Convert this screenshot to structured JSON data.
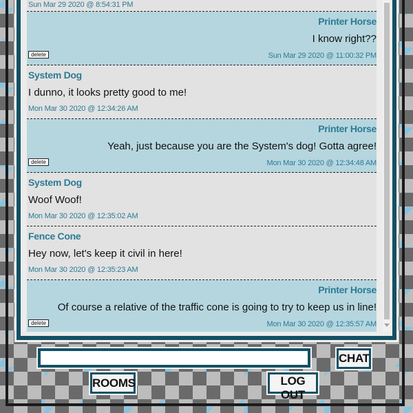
{
  "messages": [
    {
      "author": "",
      "text": "",
      "time": "Sun Mar 29 2020 @ 8:54:31 PM",
      "own": false
    },
    {
      "author": "Printer Horse",
      "text": "I know right??",
      "time": "Sun Mar 29 2020 @ 11:00:32 PM",
      "own": true,
      "delete_label": "delete"
    },
    {
      "author": "System Dog",
      "text": "I dunno, it looks pretty good to me!",
      "time": "Mon Mar 30 2020 @ 12:34:26 AM",
      "own": false
    },
    {
      "author": "Printer Horse",
      "text": "Yeah, just because you are the System's dog! Gotta agree!",
      "time": "Mon Mar 30 2020 @ 12:34:48 AM",
      "own": true,
      "delete_label": "delete"
    },
    {
      "author": "System Dog",
      "text": "Woof Woof!",
      "time": "Mon Mar 30 2020 @ 12:35:02 AM",
      "own": false
    },
    {
      "author": "Fence Cone",
      "text": "Hey now, let's keep it civil in here!",
      "time": "Mon Mar 30 2020 @ 12:35:23 AM",
      "own": false
    },
    {
      "author": "Printer Horse",
      "text": "Of course a relative of the traffic cone is going to try to keep us in line!",
      "time": "Mon Mar 30 2020 @ 12:35:57 AM",
      "own": true,
      "delete_label": "delete"
    }
  ],
  "composer": {
    "input_value": "",
    "chat_button": "CHAT"
  },
  "footer": {
    "rooms_button": "ROOMS",
    "logout_button": "LOG OUT"
  },
  "colors": {
    "accent": "#145064",
    "author": "#2d7a94",
    "own_message_bg": "#b5d6df",
    "other_message_bg": "#e2e2e2"
  }
}
